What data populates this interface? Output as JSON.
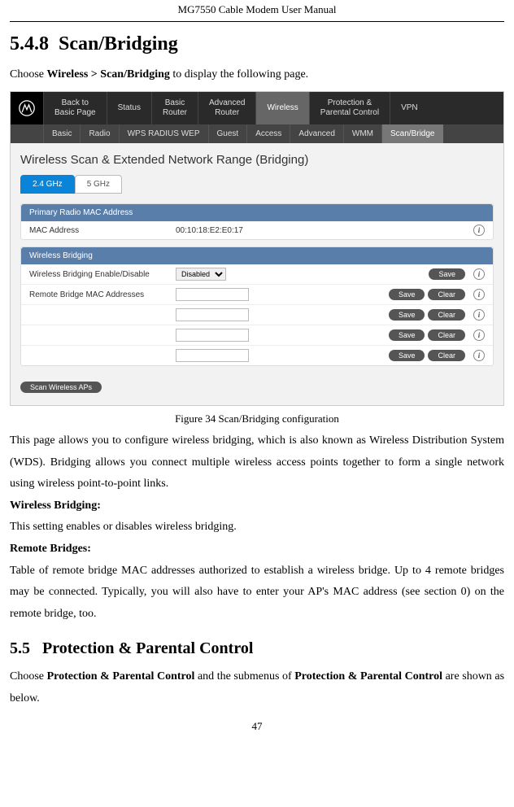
{
  "header": "MG7550 Cable Modem User Manual",
  "section_number": "5.4.8",
  "section_title": "Scan/Bridging",
  "intro_prefix": "Choose ",
  "intro_bold": "Wireless > Scan/Bridging",
  "intro_suffix": " to display the following page.",
  "screenshot": {
    "nav_top": [
      {
        "label1": "Back to",
        "label2": "Basic Page"
      },
      {
        "label1": "Status",
        "label2": ""
      },
      {
        "label1": "Basic",
        "label2": "Router"
      },
      {
        "label1": "Advanced",
        "label2": "Router"
      },
      {
        "label1": "Wireless",
        "label2": ""
      },
      {
        "label1": "Protection &",
        "label2": "Parental Control"
      },
      {
        "label1": "VPN",
        "label2": ""
      }
    ],
    "nav_sub": [
      "Basic",
      "Radio",
      "WPS RADIUS WEP",
      "Guest",
      "Access",
      "Advanced",
      "WMM",
      "Scan/Bridge"
    ],
    "panel_title": "Wireless Scan & Extended Network Range (Bridging)",
    "tabs": [
      "2.4 GHz",
      "5 GHz"
    ],
    "card1": {
      "header": "Primary Radio MAC Address",
      "row_label": "MAC Address",
      "row_value": "00:10:18:E2:E0:17"
    },
    "card2": {
      "header": "Wireless Bridging",
      "row1_label": "Wireless Bridging Enable/Disable",
      "row1_select": "Disabled",
      "row1_btn": "Save",
      "row2_label": "Remote Bridge MAC Addresses",
      "btn_save": "Save",
      "btn_clear": "Clear"
    },
    "scan_btn": "Scan Wireless APs",
    "info_glyph": "i"
  },
  "figure_caption": "Figure 34 Scan/Bridging configuration",
  "body": {
    "p1": "This page allows you to configure wireless bridging, which is also known as Wireless Distribution System (WDS). Bridging allows you connect multiple wireless access points together to form a single network using wireless point-to-point links.",
    "h1": "Wireless Bridging:",
    "p2": "This setting enables or disables wireless bridging.",
    "h2": "Remote Bridges:",
    "p3": "Table of remote bridge MAC addresses authorized to establish a wireless bridge. Up to 4 remote bridges may be connected. Typically, you will also have to enter your AP's MAC address (see section 0) on the remote bridge, too."
  },
  "section2_number": "5.5",
  "section2_title": "Protection & Parental Control",
  "section2_intro_prefix": "Choose ",
  "section2_intro_bold1": "Protection & Parental Control",
  "section2_intro_mid": " and the submenus of ",
  "section2_intro_bold2": "Protection & Parental Control",
  "section2_intro_suffix": " are shown as below.",
  "page_number": "47"
}
